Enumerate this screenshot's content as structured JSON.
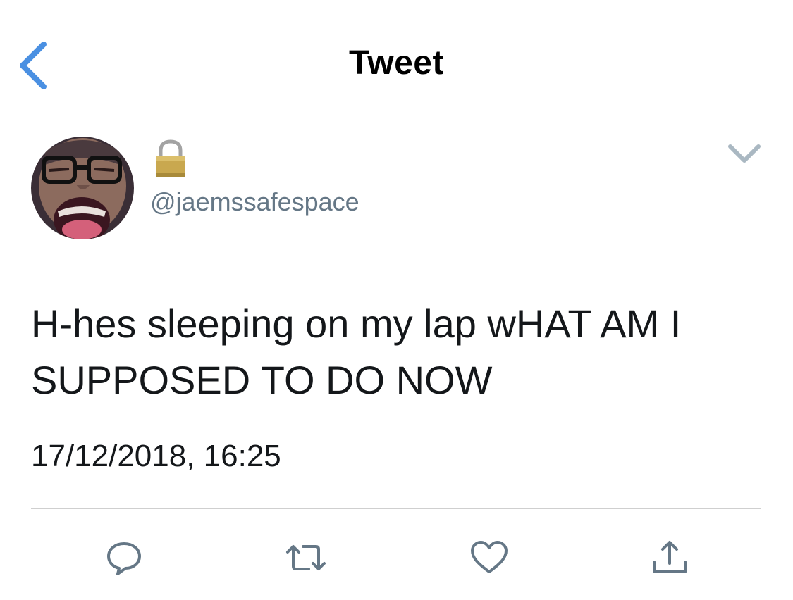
{
  "nav": {
    "title": "Tweet",
    "back_icon": "chevron-left-icon"
  },
  "tweet": {
    "handle": "@jaemssafespace",
    "protected_icon": "lock-icon",
    "text": "H-hes sleeping on my lap wHAT AM I SUPPOSED TO DO NOW",
    "timestamp": "17/12/2018, 16:25",
    "menu_icon": "chevron-down-icon"
  },
  "actions": [
    {
      "icon": "reply-icon"
    },
    {
      "icon": "retweet-icon"
    },
    {
      "icon": "like-icon"
    },
    {
      "icon": "share-icon"
    }
  ],
  "colors": {
    "accent": "#4a90e2",
    "secondary_text": "#657786",
    "divider": "#cfcfcf",
    "icon_gray": "#657786"
  }
}
